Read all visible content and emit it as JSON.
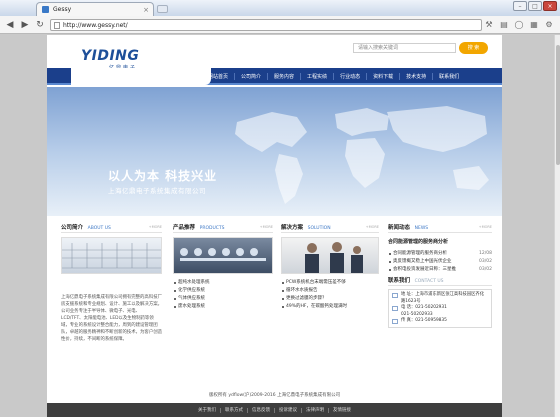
{
  "browser": {
    "tab_title": "Gessy",
    "tab_close": "×",
    "url": "http://www.gessy.net/",
    "window_buttons": [
      "–",
      "□",
      "×"
    ]
  },
  "header": {
    "logo_main": "YIDING",
    "logo_sub": "亿鼎电子",
    "search_placeholder": "请输入搜索关键词",
    "search_button": "搜 索"
  },
  "nav": {
    "items": [
      "网站首页",
      "公司简介",
      "服务内容",
      "工程实绩",
      "行业动态",
      "资料下载",
      "技术支持",
      "联系我们"
    ]
  },
  "banner": {
    "title": "以人为本 科技兴业",
    "subtitle": "上海亿鼎电子系统集成有限公司"
  },
  "columns": {
    "about": {
      "title_cn": "公司简介",
      "title_en": "ABOUT US",
      "more": "+MORE",
      "text": "上海亿鼎电子系统集成有限公司拥有完整的高科技厂房支援系统和专业规划、设计、施工以及解决方案。公司业务专注于半导体、微电子、光电、LCD/TFT、太阳能电池、LED以及生物制药等领域，专业的系统设计整合能力，周到的建设管理团队，卓越的服务精神和不断创新的技术，为客户创造性价，持续，不间断的系统保障。"
    },
    "products": {
      "title_cn": "产品推荐",
      "title_en": "PRODUCTS",
      "more": "+MORE",
      "items": [
        "超纯水处理系统",
        "化学供应系统",
        "气体供应系统",
        "废水处理系统"
      ]
    },
    "solutions": {
      "title_cn": "解决方案",
      "title_en": "SOLUTION",
      "more": "+MORE",
      "items": [
        "PCW系统机台末端需压差不够",
        "循环水水质报告",
        "更换过滤膜的步骤？",
        "49%的HF，在碳酸钙处理满时"
      ]
    },
    "news": {
      "title_cn": "新闻动态",
      "title_en": "NEWS",
      "more": "+MORE",
      "feature": "合同能源管理的服务商分析",
      "items": [
        {
          "text": "合同能源管理的服务商分析",
          "date": "12/08"
        },
        {
          "text": "奥反馈概又稳上中国光伏企业",
          "date": "03/02"
        },
        {
          "text": "会积电投资发展近日称：三星推",
          "date": "03/02"
        }
      ]
    },
    "contact": {
      "title_cn": "联系我们",
      "title_en": "CONTACT US",
      "rows": [
        "地 址：上海市浦东新区张江高科技园区齐化路1623号",
        "电 话：021-50202931",
        "021-50202933",
        "传 真：021-50959835"
      ]
    }
  },
  "footer": {
    "links": [
      "关于我们",
      "联系方式",
      "信息反馈",
      "投诉建议",
      "法律声明",
      "友情链接"
    ],
    "copyright": "版权所有 ydflow(沪)2009-2016 上海亿鼎电子系统集成有限公司"
  }
}
